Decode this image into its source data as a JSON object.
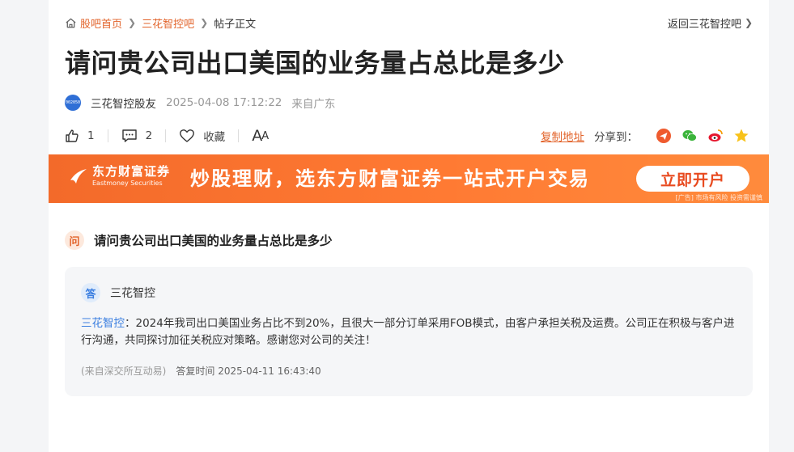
{
  "breadcrumb": {
    "home": "股吧首页",
    "forum": "三花智控吧",
    "current": "帖子正文",
    "back": "返回三花智控吧"
  },
  "post": {
    "title": "请问贵公司出口美国的业务量占总比是多少",
    "author_avatar": "002050",
    "author": "三花智控股友",
    "time": "2025-04-08 17:12:22",
    "from": "来自广东"
  },
  "actions": {
    "like_count": "1",
    "comment_count": "2",
    "favorite_label": "收藏",
    "font_big": "A",
    "font_small": "A"
  },
  "share": {
    "copy_link": "复制地址",
    "share_to": "分享到："
  },
  "banner": {
    "brand_cn": "东方财富证券",
    "brand_en": "Eastmoney Securities",
    "slogan": "炒股理财，选东方财富证券一站式开户交易",
    "cta": "立即开户",
    "ad_note": "[广告] 市场有风险 投资需谨慎"
  },
  "question": {
    "badge": "问",
    "text": "请问贵公司出口美国的业务量占总比是多少"
  },
  "answer": {
    "badge": "答",
    "responder": "三花智控",
    "body_prefix": "三花智控",
    "body": "：2024年我司出口美国业务占比不到20%，且很大一部分订单采用FOB模式，由客户承担关税及运费。公司正在积极与客户进行沟通，共同探讨加征关税应对策略。感谢您对公司的关注！",
    "source": "(来自深交所互动易)",
    "reply_time": "答复时间 2025-04-11 16:43:40"
  },
  "colors": {
    "accent": "#e2632a",
    "link_blue": "#3a7ee0",
    "banner": "#f36a2a"
  }
}
